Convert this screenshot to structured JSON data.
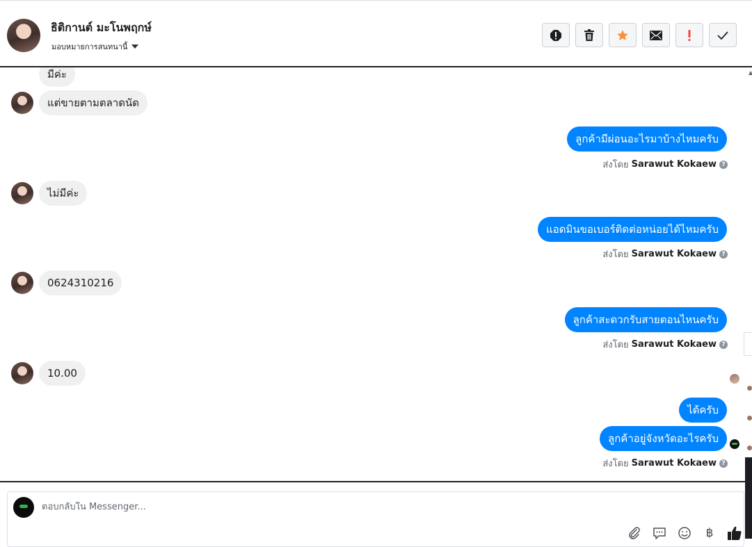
{
  "header": {
    "contact_name": "ธิติกานต์ มะโนพฤกษ์",
    "assign_label": "มอบหมายการสนทนานี้",
    "actions": [
      {
        "icon": "alert-circle-icon",
        "name": "mark-spam-button"
      },
      {
        "icon": "trash-icon",
        "name": "delete-button"
      },
      {
        "icon": "star-icon",
        "name": "star-button",
        "color": "#f7923a"
      },
      {
        "icon": "envelope-icon",
        "name": "mark-unread-button"
      },
      {
        "icon": "exclamation-icon",
        "name": "follow-up-button",
        "color": "#fa3e3e"
      },
      {
        "icon": "check-icon",
        "name": "mark-done-button"
      }
    ]
  },
  "messages": {
    "m1": "มีค่ะ",
    "m2": "แต่ขายตามตลาดนัด",
    "m3": "ลูกค้ามีผ่อนอะไรมาบ้างไหมครับ",
    "m4": "ไม่มีค่ะ",
    "m5": "แอดมินขอเบอร์ติดต่อหน่อยได้ไหมครับ",
    "m6": "0624310216",
    "m7": "ลูกค้าสะดวกรับสายตอนไหนครับ",
    "m8": "10.00",
    "m9": "ได้ครับ",
    "m10": "ลูกค้าอยู่จังหวัดอะไรครับ",
    "sent_by_prefix": "ส่งโดย",
    "sender_name": "Sarawut Kokaew"
  },
  "composer": {
    "placeholder": "ตอบกลับใน Messenger...",
    "tools": [
      "attachment-icon",
      "saved-reply-icon",
      "emoji-icon",
      "baht-icon",
      "thumbs-up-icon"
    ],
    "baht_symbol": "฿"
  },
  "colors": {
    "outgoing_bubble": "#0084ff",
    "incoming_bubble": "#f0f0f0"
  }
}
